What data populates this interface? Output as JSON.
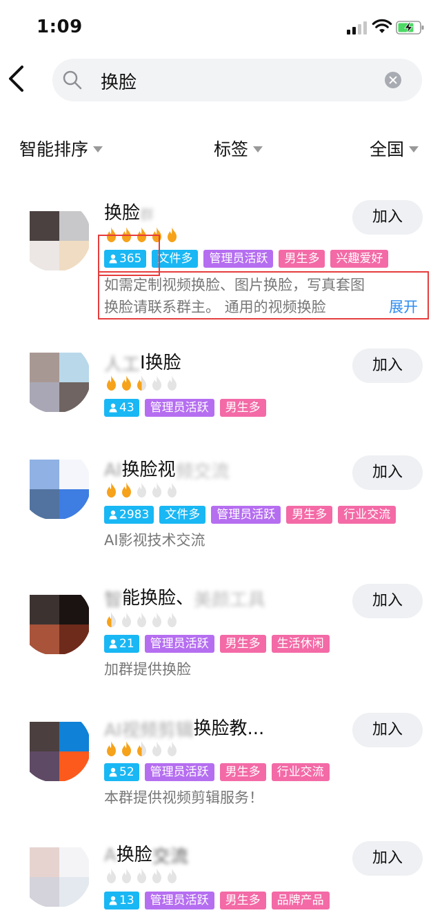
{
  "status_bar": {
    "time": "1:09"
  },
  "search": {
    "query": "换脸"
  },
  "filters": {
    "sort": "智能排序",
    "tags": "标签",
    "region": "全国"
  },
  "groups": [
    {
      "title": "换脸",
      "title_hidden": "群",
      "heat": 5,
      "heat_max": 5,
      "member_count": "365",
      "tags": [
        "文件多",
        "管理员活跃",
        "男生多",
        "兴趣爱好"
      ],
      "description_line1": "如需定制视频换脸、图片换脸，写真套图",
      "description_line2": "换脸请联系群主。 通用的视频换脸",
      "expand_label": "展开",
      "join_label": "加入",
      "avatar_colors": [
        "#4a4140",
        "#c8c8ca",
        "#ece7e4",
        "#f0dcc2"
      ]
    },
    {
      "title_hidden": "人工",
      "title": "I换脸",
      "heat": 2.5,
      "heat_max": 5,
      "member_count": "43",
      "tags": [
        "管理员活跃",
        "男生多"
      ],
      "description": "",
      "join_label": "加入",
      "avatar_colors": [
        "#a89893",
        "#b9d8ea",
        "#a9a7b5",
        "#6f6461"
      ]
    },
    {
      "title_hidden": "AI",
      "title": "换脸视",
      "title_hidden2": "频交流",
      "heat": 2,
      "heat_max": 5,
      "member_count": "2983",
      "tags": [
        "文件多",
        "管理员活跃",
        "男生多",
        "行业交流"
      ],
      "description": "AI影视技术交流",
      "join_label": "加入",
      "avatar_colors": [
        "#8fb1e3",
        "#f4f6fb",
        "#52739f",
        "#3e7de2"
      ]
    },
    {
      "title_hidden": "智",
      "title": "能换脸、",
      "title_hidden2": "美颜工具",
      "heat": 0.5,
      "heat_max": 5,
      "member_count": "21",
      "tags": [
        "管理员活跃",
        "男生多",
        "生活休闲"
      ],
      "description": "加群提供换脸",
      "join_label": "加入",
      "avatar_colors": [
        "#3c3331",
        "#1a1311",
        "#a8533a",
        "#6e2b1b"
      ]
    },
    {
      "title_hidden": "AI视频剪辑",
      "title": "换脸教...",
      "heat": 2.5,
      "heat_max": 5,
      "member_count": "52",
      "tags": [
        "管理员活跃",
        "男生多",
        "行业交流"
      ],
      "description": "本群提供视频剪辑服务！",
      "join_label": "加入",
      "avatar_colors": [
        "#4b403f",
        "#0f81d6",
        "#5f4a66",
        "#fb5a1c"
      ]
    },
    {
      "title_hidden": "A",
      "title": "换脸",
      "title_hidden2": "交流",
      "heat": 0,
      "heat_max": 5,
      "member_count": "13",
      "tags": [
        "管理员活跃",
        "男生多",
        "品牌产品"
      ],
      "description": "",
      "join_label": "加入",
      "avatar_colors": [
        "#e6d3cf",
        "#f4f4f6",
        "#d4d2da",
        "#e3e9ee"
      ]
    }
  ],
  "colors": {
    "tag_blue": "#19b7f4",
    "tag_purple": "#b56ef0",
    "tag_pink": "#f36aa6",
    "flame_on": "#f6a21a",
    "flame_off": "#e4e4e4",
    "highlight_box": "#e53c3c",
    "expand_link": "#2d8cf0"
  }
}
